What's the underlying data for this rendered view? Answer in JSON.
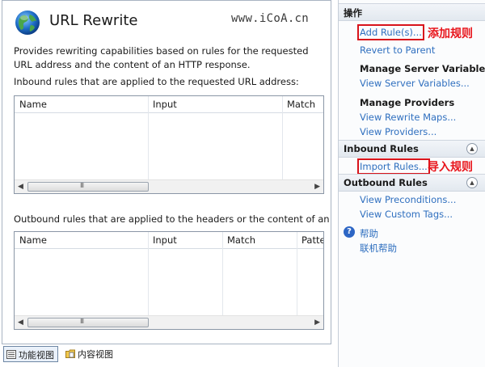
{
  "main": {
    "title": "URL Rewrite",
    "watermark": "www.iCoA.cn",
    "description": "Provides rewriting capabilities based on rules for the requested URL address and the content of an HTTP response.",
    "inbound_label": "Inbound rules that are applied to the requested URL address:",
    "inbound_columns": [
      "Name",
      "Input",
      "Match"
    ],
    "outbound_label": "Outbound rules that are applied to the headers or the content of an HT",
    "outbound_columns": [
      "Name",
      "Input",
      "Match",
      "Patte"
    ],
    "scroll_grip": "III"
  },
  "bottom_tabs": [
    {
      "label": "功能视图",
      "active": true
    },
    {
      "label": "内容视图",
      "active": false
    }
  ],
  "actions": {
    "header": "操作",
    "add_rule": "Add Rule(s)...",
    "add_rule_annotation": "添加规则",
    "revert": "Revert to Parent",
    "server_vars_header": "Manage Server Variables",
    "view_server_vars": "View Server Variables...",
    "providers_header": "Manage Providers",
    "view_rewrite_maps": "View Rewrite Maps...",
    "view_providers": "View Providers...",
    "inbound_header": "Inbound Rules",
    "import_rules": "Import Rules...",
    "import_annotation": "导入规则",
    "outbound_header": "Outbound Rules",
    "view_preconditions": "View Preconditions...",
    "view_custom_tags": "View Custom Tags...",
    "help": "帮助",
    "online_help": "联机帮助"
  },
  "colors": {
    "link": "#2f6fbf",
    "annotation": "#e8141b"
  },
  "icons": {
    "title": "globe-icon",
    "help": "help-icon",
    "collapse": "chevron-up-icon"
  }
}
